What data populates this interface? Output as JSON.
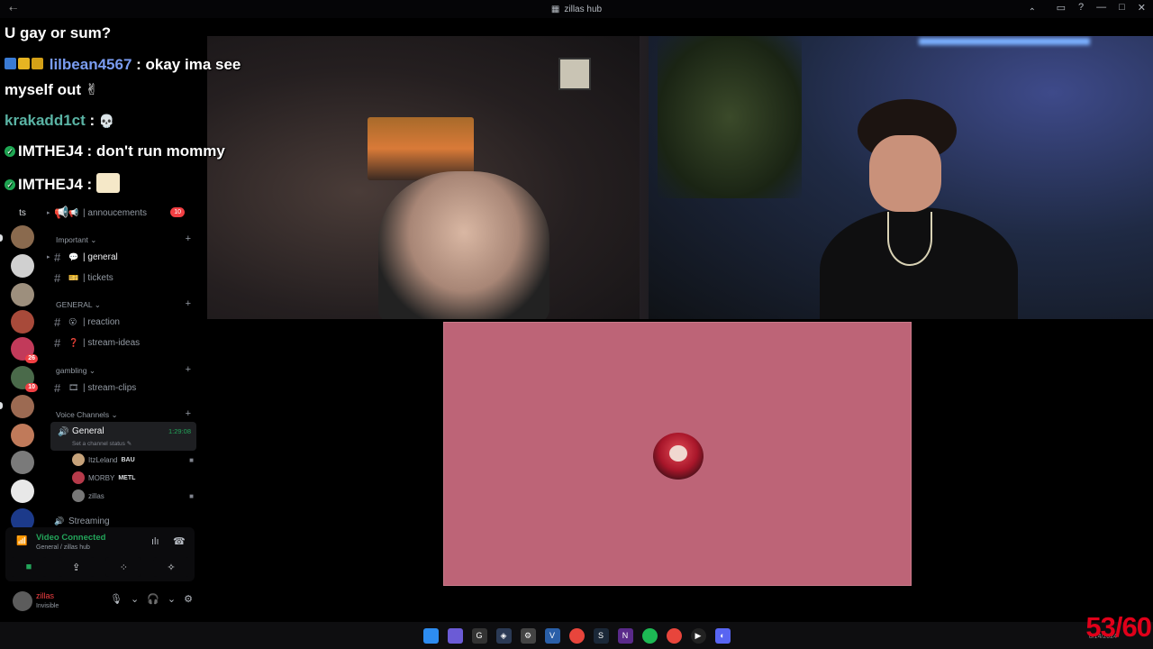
{
  "window": {
    "title": "zillas hub",
    "back_glyph": "⇠",
    "controls": [
      "▭",
      "?",
      "—",
      "□",
      "✕"
    ]
  },
  "rail": {
    "ts_label": "ts",
    "servers": [
      {
        "color": "#8a6a4e",
        "badge": ""
      },
      {
        "color": "#d0d0d0",
        "badge": ""
      },
      {
        "color": "#9d8f7d",
        "badge": ""
      },
      {
        "color": "#a84a3a",
        "badge": ""
      },
      {
        "color": "#c23a5a",
        "badge": "26"
      },
      {
        "color": "#4a6a4a",
        "badge": "10"
      },
      {
        "color": "#9c6a52",
        "badge": ""
      },
      {
        "color": "#c07a5a",
        "badge": ""
      },
      {
        "color": "#7a7a7a",
        "badge": ""
      },
      {
        "color": "#e8e8e8",
        "badge": ""
      },
      {
        "color": "#1c3a8a",
        "badge": ""
      }
    ]
  },
  "sidebar": {
    "channels_top": [
      {
        "name": "| annoucements",
        "emoji": "📢",
        "badge": "10"
      }
    ],
    "categories": [
      {
        "label": "Important",
        "chevron": "⌄",
        "channels": [
          {
            "name": "| general",
            "emoji": "💬",
            "active": true
          },
          {
            "name": "| tickets",
            "emoji": "🎫",
            "active": false
          }
        ]
      },
      {
        "label": "GENERAL",
        "chevron": "⌄",
        "channels": [
          {
            "name": "| reaction",
            "emoji": "😮"
          },
          {
            "name": "| stream-ideas",
            "emoji": "❓"
          }
        ]
      },
      {
        "label": "gambling",
        "chevron": "⌄",
        "channels": [
          {
            "name": "| stream-clips",
            "emoji": "🎞"
          }
        ]
      },
      {
        "label": "Voice Channels",
        "chevron": "⌄",
        "channels": []
      }
    ],
    "voice": {
      "channel_name": "General",
      "status_placeholder": "Set a channel status ✎",
      "duration": "1:29:08",
      "users": [
        {
          "name": "ItzLeland",
          "tag": "BAU",
          "color": "#c6a27a"
        },
        {
          "name": "MORBY",
          "tag": "METL",
          "color": "#b63a4a"
        },
        {
          "name": "zillas",
          "tag": "",
          "color": "#777"
        }
      ],
      "next_channel": "Streaming"
    },
    "voice_panel": {
      "status": "Video Connected",
      "location": "General / zillas hub",
      "buttons": [
        "■",
        "⇪",
        "⁘",
        "✧"
      ]
    },
    "user_panel": {
      "name": "zillas",
      "status": "Invisible",
      "controls": [
        "🎙",
        "⌄",
        "🎧",
        "⌄",
        "⚙"
      ]
    }
  },
  "chat": {
    "lines": [
      {
        "id": "l1",
        "text": "U gay or sum?"
      },
      {
        "id": "l2",
        "user": "lilbean4567",
        "text": " : okay ima see"
      },
      {
        "id": "l3",
        "text": "myself out ✌"
      },
      {
        "id": "l4",
        "user": "krakadd1ct",
        "text": " :"
      },
      {
        "id": "l5",
        "user": "IMTHEJ4",
        "text": " : don't run mommy"
      },
      {
        "id": "l6",
        "user": "IMTHEJ4",
        "text": " :"
      }
    ]
  },
  "taskbar": {
    "fps": "53/60",
    "date": "8/14/2024",
    "tray_caret": "⌃"
  },
  "colors": {
    "accent_green": "#23a55a",
    "share_bg": "#bd6477",
    "danger": "#f23f43"
  }
}
